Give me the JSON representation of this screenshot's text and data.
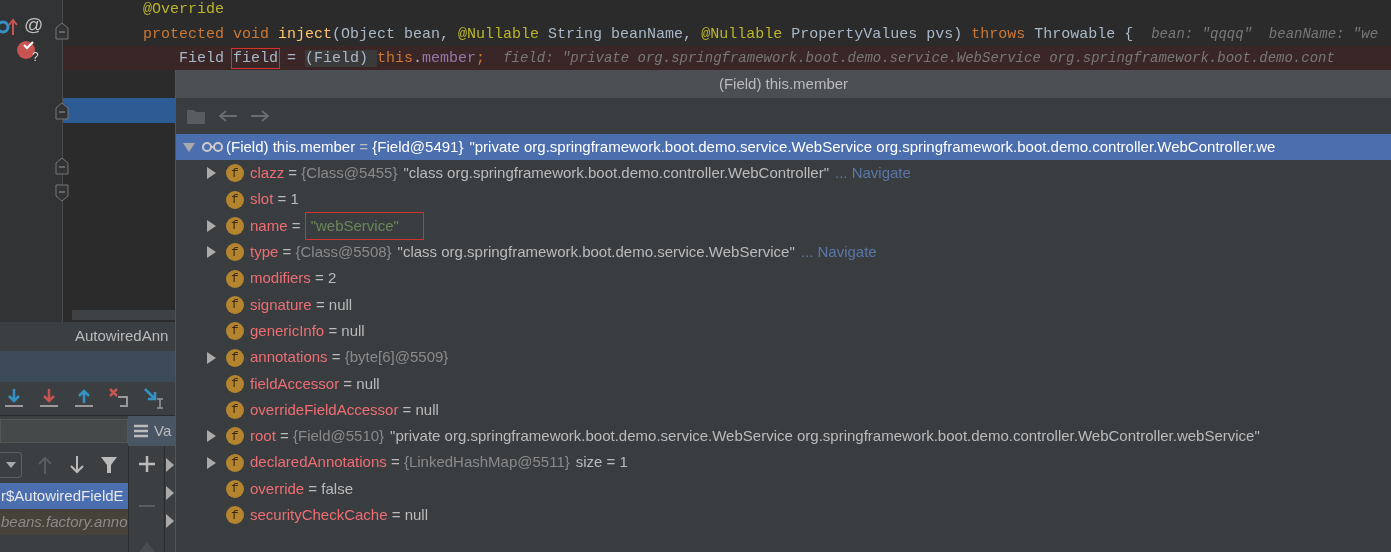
{
  "editor": {
    "gutter_mark": "@",
    "breakpoint_badge": "?",
    "lines": [
      {
        "highlighted": false,
        "tokens": [
          {
            "kind": "annotation",
            "text": "@Override"
          }
        ]
      },
      {
        "highlighted": false,
        "tokens": [
          {
            "kind": "keyword",
            "text": "protected void"
          },
          {
            "kind": "method",
            "text": " inject"
          },
          {
            "kind": "plain",
            "text": "(Object bean, "
          },
          {
            "kind": "annotation",
            "text": "@Nullable"
          },
          {
            "kind": "plain",
            "text": " String beanName, "
          },
          {
            "kind": "annotation",
            "text": "@Nullable"
          },
          {
            "kind": "plain",
            "text": " PropertyValues pvs) "
          },
          {
            "kind": "keyword",
            "text": "throws"
          },
          {
            "kind": "plain",
            "text": " Throwable {"
          },
          {
            "kind": "hint",
            "text": "bean: \"qqqq\"  beanName: \"we"
          }
        ]
      },
      {
        "highlighted": true,
        "tokens": [
          {
            "kind": "plain",
            "text": "    Field "
          },
          {
            "kind": "boxed",
            "text": "field"
          },
          {
            "kind": "plain",
            "text": " = "
          },
          {
            "kind": "selection",
            "text": "(Field) "
          },
          {
            "kind": "keyword",
            "text": "this"
          },
          {
            "kind": "plain",
            "text": "."
          },
          {
            "kind": "field",
            "text": "member"
          },
          {
            "kind": "keyword",
            "text": ";"
          },
          {
            "kind": "hint",
            "text": "field: \"private org.springframework.boot.demo.service.WebService org.springframework.boot.demo.cont"
          }
        ]
      }
    ]
  },
  "debugger": {
    "tab": "AutowiredAnn",
    "variables_tab": "Va",
    "frames": [
      {
        "text": "r$AutowiredFieldE",
        "selected": true
      },
      {
        "text": "beans.factory.anno",
        "selected": false
      }
    ]
  },
  "popup": {
    "title": "(Field) this.member",
    "root": {
      "name": "(Field) this.member",
      "sep": "=",
      "ref": "{Field@5491}",
      "value": "\"private org.springframework.boot.demo.service.WebService org.springframework.boot.demo.controller.WebController.we",
      "selected": true,
      "expanded": true,
      "children": [
        {
          "kind": "node",
          "expanded": false,
          "badge": "f",
          "name": "clazz",
          "sep": "=",
          "ref": "{Class@5455}",
          "value": "\"class org.springframework.boot.demo.controller.WebController\"",
          "link": "... Navigate"
        },
        {
          "kind": "leaf",
          "badge": "f",
          "name": "slot",
          "sep": "=",
          "value": "1"
        },
        {
          "kind": "node",
          "expanded": false,
          "badge": "f",
          "name": "name",
          "sep": "=",
          "value": "\"webService\"",
          "string_value": true,
          "marked": true
        },
        {
          "kind": "node",
          "expanded": false,
          "badge": "f",
          "name": "type",
          "sep": "=",
          "ref": "{Class@5508}",
          "value": "\"class org.springframework.boot.demo.service.WebService\"",
          "link": "... Navigate"
        },
        {
          "kind": "leaf",
          "badge": "f",
          "name": "modifiers",
          "sep": "=",
          "value": "2"
        },
        {
          "kind": "leaf",
          "badge": "f",
          "name": "signature",
          "sep": "=",
          "value": "null"
        },
        {
          "kind": "leaf",
          "badge": "f",
          "name": "genericInfo",
          "sep": "=",
          "value": "null"
        },
        {
          "kind": "node",
          "expanded": false,
          "badge": "f",
          "name": "annotations",
          "sep": "=",
          "ref": "{byte[6]@5509}"
        },
        {
          "kind": "leaf",
          "badge": "f",
          "name": "fieldAccessor",
          "sep": "=",
          "value": "null"
        },
        {
          "kind": "leaf",
          "badge": "f",
          "name": "overrideFieldAccessor",
          "sep": "=",
          "value": "null"
        },
        {
          "kind": "node",
          "expanded": false,
          "badge": "f",
          "name": "root",
          "sep": "=",
          "ref": "{Field@5510}",
          "value": "\"private org.springframework.boot.demo.service.WebService org.springframework.boot.demo.controller.WebController.webService\""
        },
        {
          "kind": "node",
          "expanded": false,
          "badge": "f",
          "name": "declaredAnnotations",
          "sep": "=",
          "ref": "{LinkedHashMap@5511}",
          "value": "size = 1"
        },
        {
          "kind": "leaf",
          "badge": "f",
          "name": "override",
          "sep": "=",
          "value": "false"
        },
        {
          "kind": "leaf",
          "badge": "f",
          "name": "securityCheckCache",
          "sep": "=",
          "value": "null"
        }
      ]
    }
  }
}
